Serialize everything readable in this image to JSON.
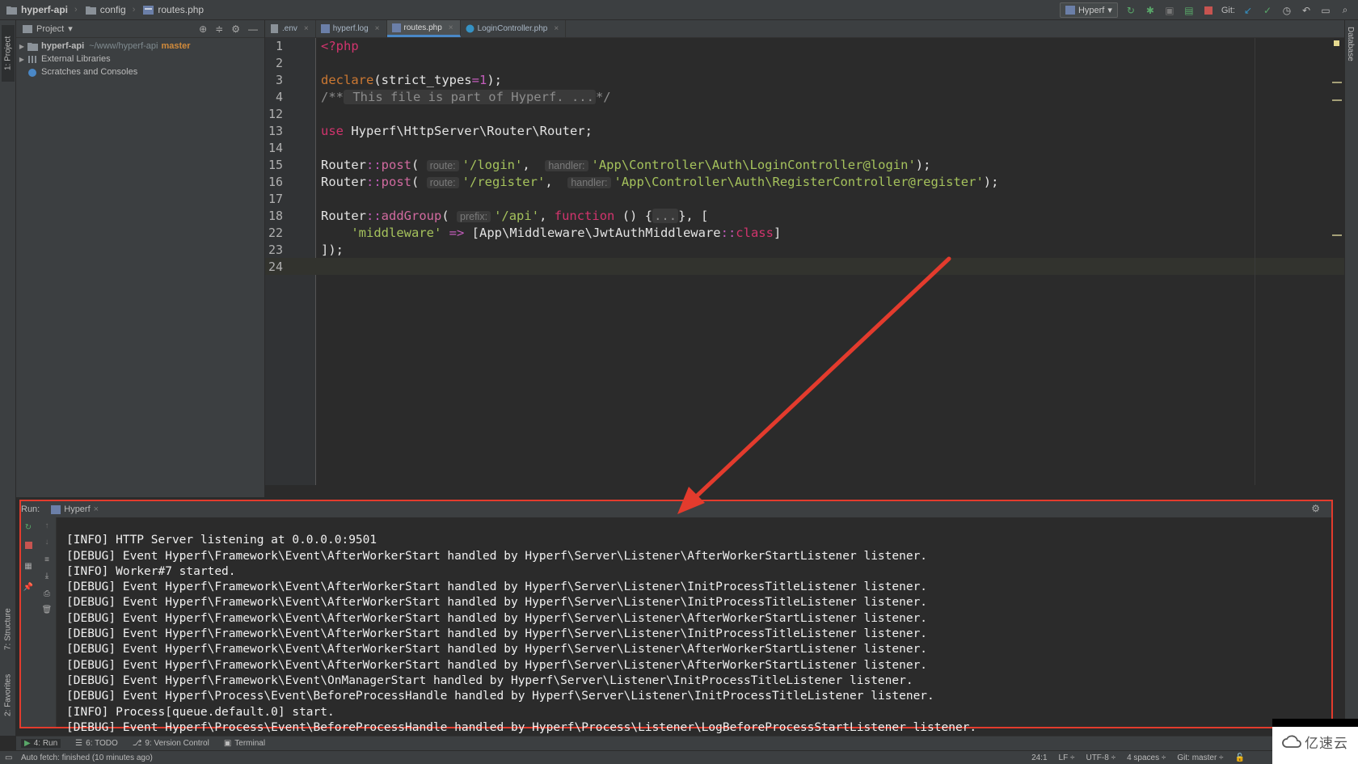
{
  "navbar": {
    "breadcrumbs": [
      "hyperf-api",
      "config",
      "routes.php"
    ],
    "run_config": "Hyperf",
    "git_label": "Git:"
  },
  "left_strip": {
    "project_tab": "1: Project",
    "structure_tab": "7: Structure",
    "favorites_tab": "2: Favorites"
  },
  "right_strip": {
    "database_tab": "Database"
  },
  "project_panel": {
    "title": "Project",
    "tree": [
      {
        "name": "hyperf-api",
        "path": "~/www/hyperf-api",
        "branch": "master"
      },
      {
        "name": "External Libraries"
      },
      {
        "name": "Scratches and Consoles"
      }
    ]
  },
  "editor": {
    "tabs": [
      {
        "label": ".env",
        "active": false
      },
      {
        "label": "hyperf.log",
        "active": false
      },
      {
        "label": "routes.php",
        "active": true
      },
      {
        "label": "LoginController.php",
        "active": false
      }
    ],
    "line_numbers": [
      "1",
      "2",
      "3",
      "4",
      "12",
      "13",
      "14",
      "15",
      "16",
      "17",
      "18",
      "22",
      "23",
      "24"
    ],
    "code": {
      "l1": "<?php",
      "l3_fn": "declare",
      "l3_rest": "(strict_types",
      "l3_eq": "=",
      "l3_num": "1",
      "l3_end": ");",
      "l4_open": "/**",
      "l4_text": " This file is part of Hyperf. ...",
      "l4_close": "*/",
      "l13_use": "use",
      "l13_rest": " Hyperf\\HttpServer\\Router\\Router;",
      "l15_cls": "Router",
      "l15_sep": "::",
      "l15_fn": "post",
      "l15_paren": "(",
      "l15_hint1": "route:",
      "l15_str1": "'/login'",
      "l15_comma": ",",
      "l15_hint2": "handler:",
      "l15_str2": "'App\\Controller\\Auth\\LoginController@login'",
      "l15_end": ");",
      "l16_cls": "Router",
      "l16_sep": "::",
      "l16_fn": "post",
      "l16_paren": "(",
      "l16_hint1": "route:",
      "l16_str1": "'/register'",
      "l16_comma": ",",
      "l16_hint2": "handler:",
      "l16_str2": "'App\\Controller\\Auth\\RegisterController@register'",
      "l16_end": ");",
      "l18_cls": "Router",
      "l18_sep": "::",
      "l18_fn": "addGroup",
      "l18_paren": "(",
      "l18_hint": "prefix:",
      "l18_str": "'/api'",
      "l18_comma": ", ",
      "l18_kw": "function",
      "l18_mid": " () {",
      "l18_fold": "...",
      "l18_end": "}, [",
      "l22_str": "'middleware'",
      "l22_arrow": "=>",
      "l22_mid": " [App\\Middleware\\JwtAuthMiddleware",
      "l22_sep": "::",
      "l22_kw": "class",
      "l22_end": "]",
      "l23": "]);"
    }
  },
  "run_panel": {
    "label": "Run:",
    "config": "Hyperf",
    "lines": [
      "[INFO] HTTP Server listening at 0.0.0.0:9501",
      "[DEBUG] Event Hyperf\\Framework\\Event\\AfterWorkerStart handled by Hyperf\\Server\\Listener\\AfterWorkerStartListener listener.",
      "[INFO] Worker#7 started.",
      "[DEBUG] Event Hyperf\\Framework\\Event\\AfterWorkerStart handled by Hyperf\\Server\\Listener\\InitProcessTitleListener listener.",
      "[DEBUG] Event Hyperf\\Framework\\Event\\AfterWorkerStart handled by Hyperf\\Server\\Listener\\InitProcessTitleListener listener.",
      "[DEBUG] Event Hyperf\\Framework\\Event\\AfterWorkerStart handled by Hyperf\\Server\\Listener\\AfterWorkerStartListener listener.",
      "[DEBUG] Event Hyperf\\Framework\\Event\\AfterWorkerStart handled by Hyperf\\Server\\Listener\\InitProcessTitleListener listener.",
      "[DEBUG] Event Hyperf\\Framework\\Event\\AfterWorkerStart handled by Hyperf\\Server\\Listener\\AfterWorkerStartListener listener.",
      "[DEBUG] Event Hyperf\\Framework\\Event\\AfterWorkerStart handled by Hyperf\\Server\\Listener\\AfterWorkerStartListener listener.",
      "[DEBUG] Event Hyperf\\Framework\\Event\\OnManagerStart handled by Hyperf\\Server\\Listener\\InitProcessTitleListener listener.",
      "[DEBUG] Event Hyperf\\Process\\Event\\BeforeProcessHandle handled by Hyperf\\Server\\Listener\\InitProcessTitleListener listener.",
      "[INFO] Process[queue.default.0] start.",
      "[DEBUG] Event Hyperf\\Process\\Event\\BeforeProcessHandle handled by Hyperf\\Process\\Listener\\LogBeforeProcessStartListener listener."
    ]
  },
  "bottom_tabs": [
    {
      "label": "4: Run",
      "active": true
    },
    {
      "label": "6: TODO",
      "active": false
    },
    {
      "label": "9: Version Control",
      "active": false
    },
    {
      "label": "Terminal",
      "active": false
    }
  ],
  "status_bar": {
    "message": "Auto fetch: finished (10 minutes ago)",
    "position": "24:1",
    "line_sep": "LF ÷",
    "encoding": "UTF-8 ÷",
    "indent": "4 spaces ÷",
    "git": "Git: master ÷"
  },
  "watermark": {
    "text": "亿速云"
  },
  "colors": {
    "annotation": "#e33b2d",
    "keyword": "#d1346d",
    "string": "#a5c25c"
  }
}
